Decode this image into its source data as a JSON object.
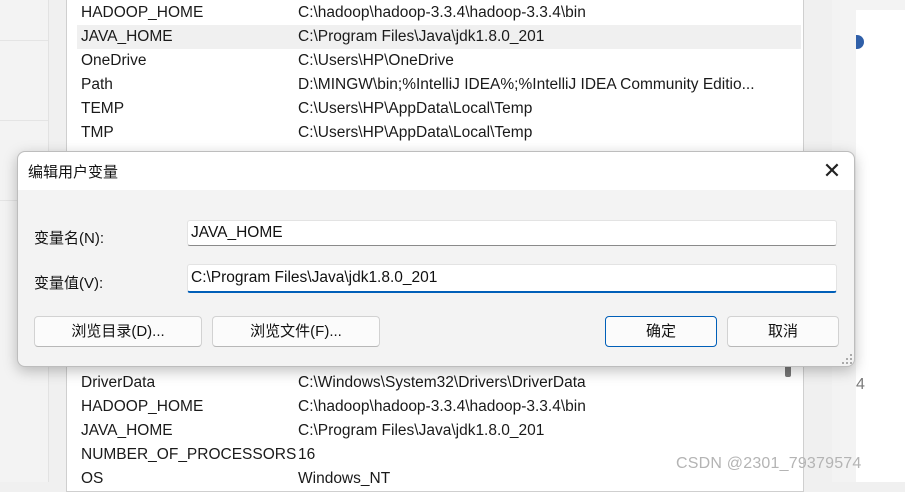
{
  "env_list_top": [
    {
      "name": "HADOOP_HOME",
      "value": "C:\\hadoop\\hadoop-3.3.4\\hadoop-3.3.4\\bin"
    },
    {
      "name": "JAVA_HOME",
      "value": "C:\\Program Files\\Java\\jdk1.8.0_201"
    },
    {
      "name": "OneDrive",
      "value": "C:\\Users\\HP\\OneDrive"
    },
    {
      "name": "Path",
      "value": "D:\\MINGW\\bin;%IntelliJ IDEA%;%IntelliJ IDEA Community Editio..."
    },
    {
      "name": "TEMP",
      "value": "C:\\Users\\HP\\AppData\\Local\\Temp"
    },
    {
      "name": "TMP",
      "value": "C:\\Users\\HP\\AppData\\Local\\Temp"
    }
  ],
  "env_list_bottom": [
    {
      "name": "DriverData",
      "value": "C:\\Windows\\System32\\Drivers\\DriverData"
    },
    {
      "name": "HADOOP_HOME",
      "value": "C:\\hadoop\\hadoop-3.3.4\\hadoop-3.3.4\\bin"
    },
    {
      "name": "JAVA_HOME",
      "value": "C:\\Program Files\\Java\\jdk1.8.0_201"
    },
    {
      "name": "NUMBER_OF_PROCESSORS",
      "value": "16"
    },
    {
      "name": "OS",
      "value": "Windows_NT"
    }
  ],
  "dialog": {
    "title": "编辑用户变量",
    "close_glyph": "✕",
    "var_name_label": "变量名(N):",
    "var_name_value": "JAVA_HOME",
    "var_value_label": "变量值(V):",
    "var_value_value": "C:\\Program Files\\Java\\jdk1.8.0_201",
    "browse_dir_label": "浏览目录(D)...",
    "browse_file_label": "浏览文件(F)...",
    "ok_label": "确定",
    "cancel_label": "取消"
  },
  "background": {
    "right_edge_digit": "4"
  },
  "watermark": "CSDN @2301_79379574",
  "colors": {
    "accent": "#005fb8",
    "selected_row": "#f0f0f0"
  }
}
